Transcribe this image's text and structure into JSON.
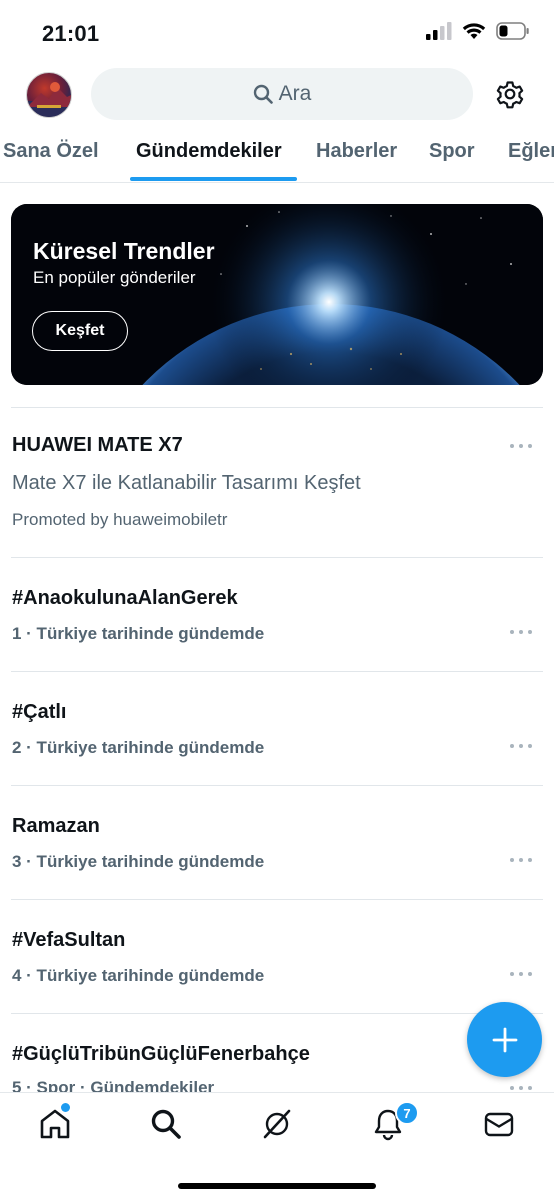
{
  "status": {
    "time": "21:01"
  },
  "search": {
    "placeholder": "Ara",
    "icon": "search-icon"
  },
  "tabs": [
    {
      "label": "Sana Özel"
    },
    {
      "label": "Gündemdekiler",
      "active": true
    },
    {
      "label": "Haberler"
    },
    {
      "label": "Spor"
    },
    {
      "label": "Eğlen"
    }
  ],
  "hero": {
    "title": "Küresel Trendler",
    "subtitle": "En popüler gönderiler",
    "button": "Keşfet"
  },
  "promoted": {
    "title": "HUAWEI MATE X7",
    "description": "Mate X7 ile Katlanabilir Tasarımı Keşfet",
    "by": "Promoted by huaweimobiletr"
  },
  "trends": [
    {
      "title": "#AnaokulunaAlanGerek",
      "meta": "1 · Türkiye tarihinde gündemde"
    },
    {
      "title": "#Çatlı",
      "meta": "2 · Türkiye tarihinde gündemde"
    },
    {
      "title": "Ramazan",
      "meta": "3 · Türkiye tarihinde gündemde"
    },
    {
      "title": "#VefaSultan",
      "meta": "4 · Türkiye tarihinde gündemde"
    },
    {
      "title": "#GüçlüTribünGüçlüFenerbahçe",
      "meta": "5 · Spor · Gündemdekiler"
    }
  ],
  "nav": {
    "notification_count": "7"
  },
  "colors": {
    "accent": "#1d9bf0",
    "text": "#0f1419",
    "muted": "#536471"
  }
}
